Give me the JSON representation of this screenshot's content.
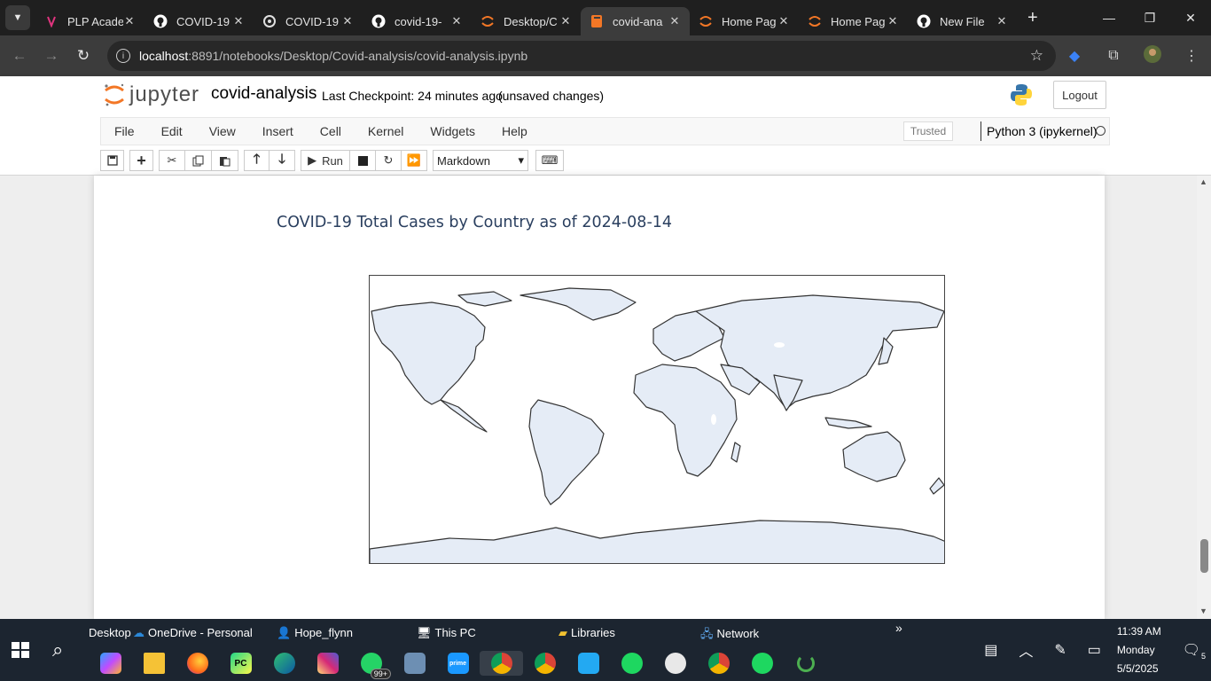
{
  "browser": {
    "tabs": [
      {
        "title": "PLP Acade",
        "icon": "plp-icon",
        "active": false
      },
      {
        "title": "COVID-19",
        "icon": "github-icon",
        "active": false
      },
      {
        "title": "COVID-19",
        "icon": "openai-icon",
        "active": false
      },
      {
        "title": "covid-19-",
        "icon": "github-icon",
        "active": false
      },
      {
        "title": "Desktop/C",
        "icon": "jupyter-icon",
        "active": false
      },
      {
        "title": "covid-ana",
        "icon": "notebook-icon",
        "active": true
      },
      {
        "title": "Home Pag",
        "icon": "jupyter-icon",
        "active": false
      },
      {
        "title": "Home Pag",
        "icon": "jupyter-icon",
        "active": false
      },
      {
        "title": "New File",
        "icon": "github-icon",
        "active": false
      }
    ],
    "url_host": "localhost",
    "url_rest": ":8891/notebooks/Desktop/Covid-analysis/covid-analysis.ipynb"
  },
  "jupyter": {
    "logo_text": "jupyter",
    "notebook_name": "covid-analysis",
    "checkpoint": "Last Checkpoint: 24 minutes ago",
    "unsaved": "(unsaved changes)",
    "logout": "Logout",
    "menu": [
      "File",
      "Edit",
      "View",
      "Insert",
      "Cell",
      "Kernel",
      "Widgets",
      "Help"
    ],
    "trusted": "Trusted",
    "kernel": "Python 3 (ipykernel)",
    "run_label": "Run",
    "cell_type": "Markdown"
  },
  "chart_data": {
    "type": "choropleth-map",
    "title": "COVID-19 Total Cases by Country as of 2024-08-14",
    "projection": "equirectangular",
    "land_color": "#e5ecf6",
    "coastline_color": "#444444"
  },
  "taskbar": {
    "folders": [
      "Desktop",
      "OneDrive - Personal",
      "Hope_flynn",
      "This PC",
      "Libraries",
      "Network"
    ],
    "apps": [
      "copilot",
      "file-explorer",
      "firefox",
      "pycharm",
      "edge",
      "instagram",
      "whatsapp",
      "network-app",
      "prime-video",
      "chrome",
      "chrome",
      "vscode",
      "spotify",
      "paint",
      "chrome",
      "spotify",
      "loader"
    ],
    "whatsapp_badge": "99+",
    "time": "11:39 AM",
    "day": "Monday",
    "date": "5/5/2025",
    "notif_count": "5"
  }
}
